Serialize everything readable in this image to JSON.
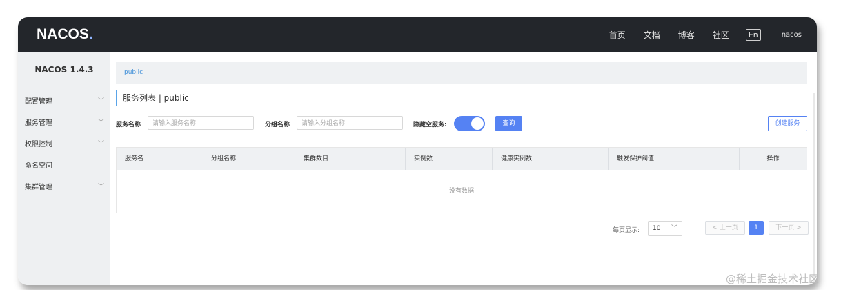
{
  "app": {
    "logo_text": "NACOS",
    "logo_accent": ".",
    "version": "NACOS 1.4.3"
  },
  "topnav": {
    "items": [
      "首页",
      "文档",
      "博客",
      "社区"
    ],
    "lang": "En",
    "user": "nacos"
  },
  "sidebar": {
    "items": [
      {
        "label": "配置管理",
        "expandable": true
      },
      {
        "label": "服务管理",
        "expandable": true
      },
      {
        "label": "权限控制",
        "expandable": true
      },
      {
        "label": "命名空间",
        "expandable": false
      },
      {
        "label": "集群管理",
        "expandable": true
      }
    ]
  },
  "breadcrumb": {
    "namespace": "public"
  },
  "page": {
    "title": "服务列表  |  public"
  },
  "filter": {
    "service_name_label": "服务名称",
    "service_name_placeholder": "请输入服务名称",
    "group_name_label": "分组名称",
    "group_name_placeholder": "请输入分组名称",
    "hide_empty_label": "隐藏空服务:",
    "hide_empty_on": true,
    "query_button": "查询",
    "create_button": "创建服务"
  },
  "table": {
    "columns": [
      "服务名",
      "分组名称",
      "集群数目",
      "实例数",
      "健康实例数",
      "触发保护阈值",
      "操作"
    ],
    "rows": [],
    "empty_text": "没有数据"
  },
  "pagination": {
    "per_page_label": "每页显示:",
    "per_page_value": "10",
    "prev_label": "< 上一页",
    "current_page": "1",
    "next_label": "下一页 >"
  },
  "watermark": "@稀土掘金技术社区",
  "colors": {
    "topbar": "#23262b",
    "primary": "#5582f3",
    "sidebar_bg": "#eef0f2",
    "link": "#3f8fd8"
  }
}
